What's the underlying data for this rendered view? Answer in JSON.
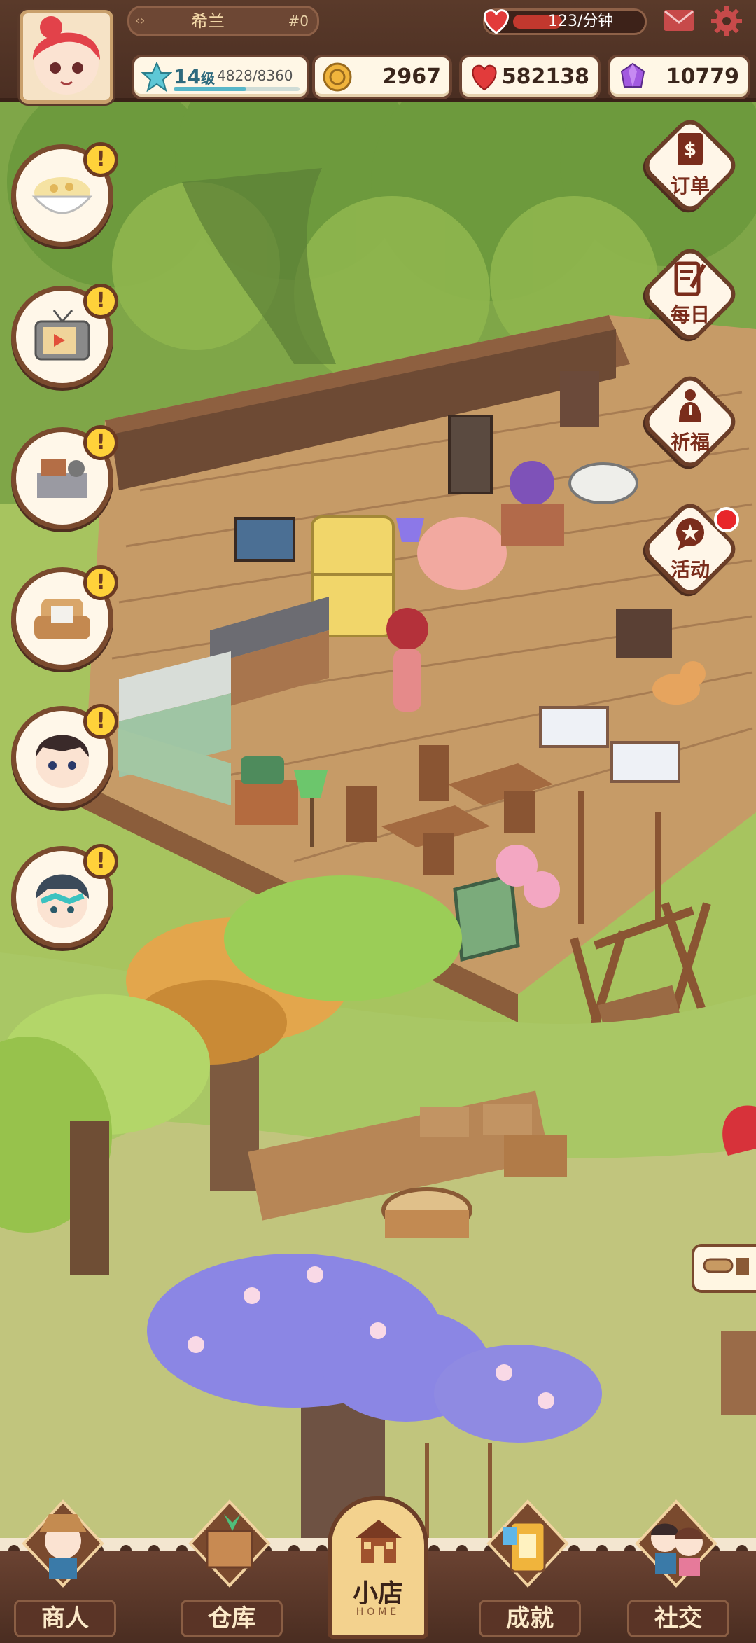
{
  "top_bar": {
    "player_name": "希兰",
    "player_id": "#0",
    "rate_text": "123/分钟",
    "icons": {
      "mail": "mail-icon",
      "settings": "gear-icon"
    }
  },
  "resources": {
    "level": {
      "value": "14",
      "unit": "级",
      "xp_text": "4828/8360",
      "xp_progress": 0.578
    },
    "coins": "2967",
    "hearts": "582138",
    "gems": "10779"
  },
  "left_buttons": [
    {
      "name": "food-dish",
      "icon": "rice-bowl-icon",
      "alert": "!"
    },
    {
      "name": "tv-video",
      "icon": "tv-icon",
      "alert": "!"
    },
    {
      "name": "equipment",
      "icon": "machine-icon",
      "alert": "!"
    },
    {
      "name": "furniture",
      "icon": "armchair-icon",
      "alert": "!"
    },
    {
      "name": "customer-boy",
      "icon": "boy-face-icon",
      "alert": "!"
    },
    {
      "name": "customer-helmet",
      "icon": "helmet-face-icon",
      "alert": "!"
    }
  ],
  "right_buttons": [
    {
      "label": "订单",
      "icon": "order-book-icon"
    },
    {
      "label": "每日",
      "icon": "daily-pencil-icon"
    },
    {
      "label": "祈福",
      "icon": "pray-figure-icon"
    },
    {
      "label": "活动",
      "icon": "event-speech-icon",
      "badge": true
    }
  ],
  "bottom_nav": {
    "items": [
      {
        "label": "商人",
        "icon": "merchant-icon"
      },
      {
        "label": "仓库",
        "icon": "warehouse-icon"
      },
      {
        "label": "小店",
        "sub": "HOME",
        "icon": "shop-house-icon",
        "active": true
      },
      {
        "label": "成就",
        "icon": "achievement-icon"
      },
      {
        "label": "社交",
        "icon": "social-couple-icon"
      }
    ]
  },
  "colors": {
    "bar_brown": "#5a3a2a",
    "badge_yellow": "#ffd23a",
    "alert_red": "#e8262a",
    "label_red": "#7a2d1c"
  }
}
